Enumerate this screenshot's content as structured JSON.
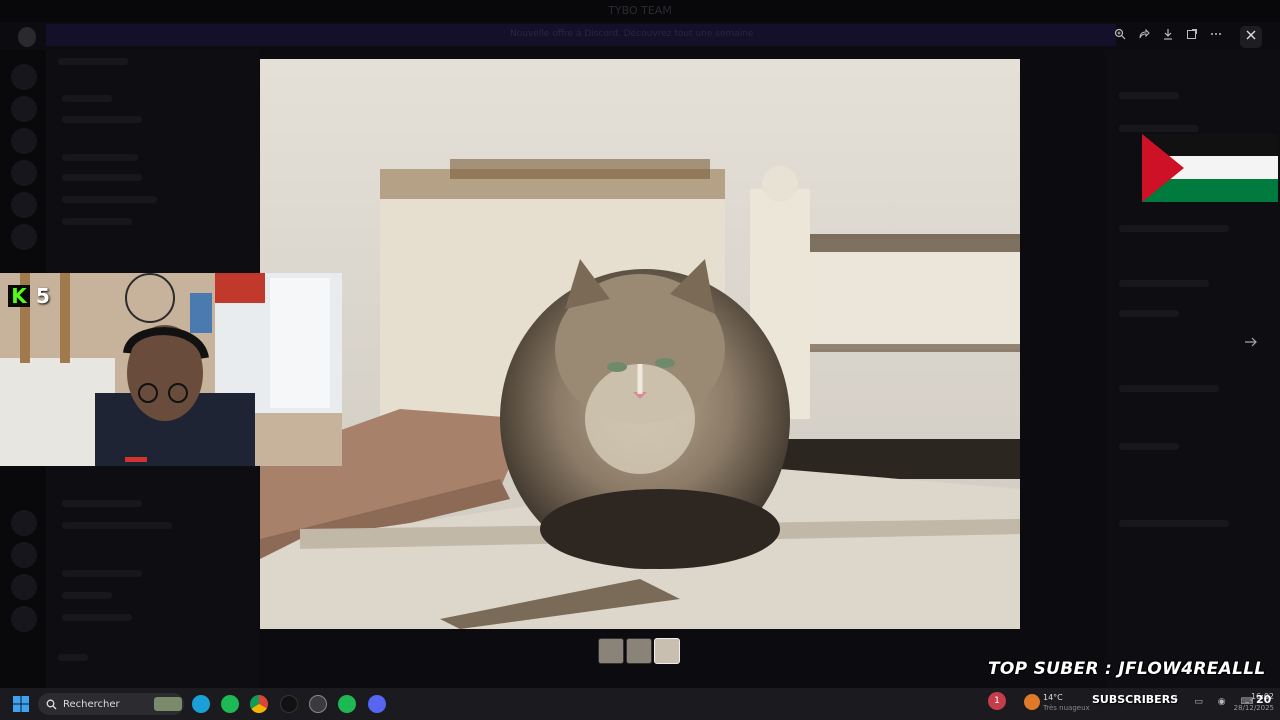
{
  "background": {
    "app_title": "TYBO TEAM",
    "banner_text": "Nouvelle offre à Discord. Découvrez tout une semaine",
    "channel_header": "TYBO TEAM",
    "clock": "16:02"
  },
  "viewer": {
    "toolbar": {
      "zoom_icon": "zoom-in-icon",
      "forward_icon": "forward-icon",
      "download_icon": "download-icon",
      "open_icon": "open-external-icon",
      "more_icon": "more-icon",
      "close_icon": "close-icon"
    },
    "next_icon": "arrow-right-icon",
    "thumbnails": 3,
    "active_thumbnail": 3
  },
  "overlay": {
    "kick_logo": "K",
    "kick_viewers": "5",
    "top_suber": "TOP SUBER : JFLOW4REALLL",
    "subscribers_label": "SUBSCRIBERS",
    "subscribers_count": "20"
  },
  "taskbar": {
    "search_placeholder": "Rechercher",
    "notification_count": "1",
    "temperature": "14°C",
    "weather_sub": "Très nuageux",
    "time": "16:02",
    "date": "28/12/2025"
  },
  "colors": {
    "kick_green": "#53fc18",
    "flag_red": "#ce1126",
    "flag_green": "#007a3d"
  }
}
